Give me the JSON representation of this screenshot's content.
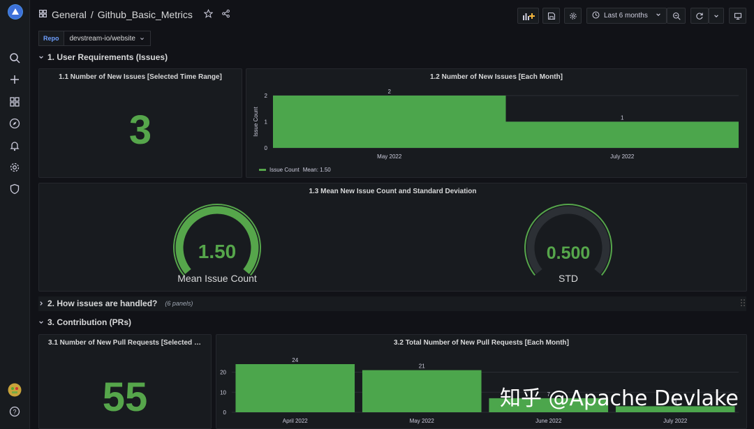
{
  "breadcrumb": {
    "folder": "General",
    "separator": "/",
    "dashboard": "Github_Basic_Metrics"
  },
  "time_picker": {
    "label": "Last 6 months"
  },
  "variable": {
    "label": "Repo",
    "value": "devstream-io/website"
  },
  "rows": [
    {
      "title": "1. User Requirements (Issues)",
      "sub": ""
    },
    {
      "title": "2. How issues are handled?",
      "sub": "(6 panels)"
    },
    {
      "title": "3. Contribution (PRs)",
      "sub": ""
    }
  ],
  "panel_1_1": {
    "title": "1.1 Number of New Issues [Selected Time Range]",
    "value": "3"
  },
  "panel_1_2": {
    "title": "1.2 Number of New Issues [Each Month]",
    "legend_name": "Issue Count",
    "legend_mean": "Mean: 1.50"
  },
  "panel_1_3": {
    "title": "1.3 Mean New Issue Count and Standard Deviation",
    "gauge1": {
      "value": "1.50",
      "label": "Mean Issue Count",
      "fraction": 1.0
    },
    "gauge2": {
      "value": "0.500",
      "label": "STD",
      "fraction": 0.0
    }
  },
  "panel_3_1": {
    "title": "3.1 Number of New Pull Requests [Selected Ti...",
    "value": "55"
  },
  "panel_3_2": {
    "title": "3.2 Total Number of New Pull Requests [Each Month]"
  },
  "watermark": "知乎 @Apache Devlake",
  "colors": {
    "green": "#56a64b",
    "bar": "#4ca64c",
    "gauge_track": "#2c3035"
  },
  "chart_data": [
    {
      "type": "bar",
      "title": "1.2 Number of New Issues [Each Month]",
      "categories": [
        "May 2022",
        "July 2022"
      ],
      "series": [
        {
          "name": "Issue Count",
          "values": [
            2,
            1
          ]
        }
      ],
      "ylabel": "Issue Count",
      "yticks": [
        "0",
        "1",
        "2"
      ],
      "ylim": [
        0,
        2
      ],
      "data_labels": [
        "2",
        "1"
      ]
    },
    {
      "type": "bar",
      "title": "3.2 Total Number of New Pull Requests [Each Month]",
      "categories": [
        "April 2022",
        "May 2022",
        "June 2022",
        "July 2022"
      ],
      "series": [
        {
          "values": [
            24,
            21,
            7,
            3
          ]
        }
      ],
      "yticks": [
        "0",
        "10",
        "20"
      ],
      "ylim": [
        0,
        24
      ],
      "data_labels": [
        "24",
        "21",
        "7",
        "3"
      ]
    }
  ]
}
